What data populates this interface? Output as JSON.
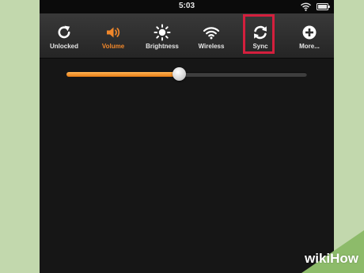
{
  "status_bar": {
    "time": "5:03",
    "wifi_icon": "wifi-icon",
    "battery_icon": "battery-icon"
  },
  "quick_settings": {
    "items": [
      {
        "label": "Unlocked",
        "icon": "rotate-unlocked-icon",
        "active": false
      },
      {
        "label": "Volume",
        "icon": "speaker-icon",
        "active": true
      },
      {
        "label": "Brightness",
        "icon": "sun-icon",
        "active": false
      },
      {
        "label": "Wireless",
        "icon": "wifi-icon",
        "active": false
      },
      {
        "label": "Sync",
        "icon": "sync-icon",
        "active": false,
        "highlighted": true
      },
      {
        "label": "More...",
        "icon": "plus-circle-icon",
        "active": false
      }
    ]
  },
  "volume_slider": {
    "value_fraction": 0.47
  },
  "colors": {
    "accent": "#f0872a",
    "highlight_box": "#d41f3d",
    "background_page": "#c2d8ad",
    "device_background": "#161616"
  },
  "watermark": {
    "text": "wikiHow"
  }
}
